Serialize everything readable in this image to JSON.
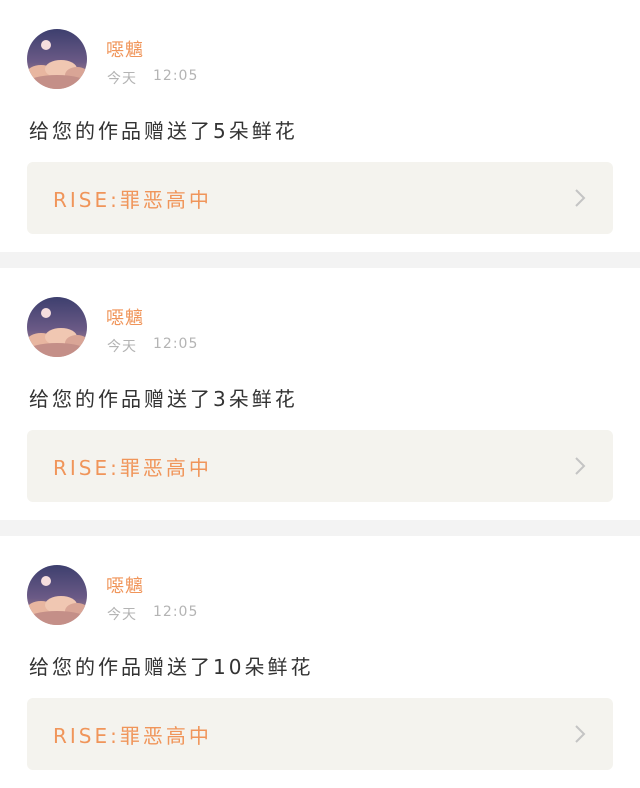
{
  "colors": {
    "accent": "#f0955a",
    "meta": "#b4b4b4",
    "text": "#333333",
    "link_bg": "#f4f3ee",
    "separator": "#f3f3f3"
  },
  "notifications": [
    {
      "user": "噁魑",
      "day": "今天",
      "time": "12:05",
      "message": "给您的作品赠送了5朵鲜花",
      "work_title": "RISE:罪恶高中",
      "avatar_icon": "avatar-moon-clouds",
      "chevron_icon": "chevron-right-icon"
    },
    {
      "user": "噁魑",
      "day": "今天",
      "time": "12:05",
      "message": "给您的作品赠送了3朵鲜花",
      "work_title": "RISE:罪恶高中",
      "avatar_icon": "avatar-moon-clouds",
      "chevron_icon": "chevron-right-icon"
    },
    {
      "user": "噁魑",
      "day": "今天",
      "time": "12:05",
      "message": "给您的作品赠送了10朵鲜花",
      "work_title": "RISE:罪恶高中",
      "avatar_icon": "avatar-moon-clouds",
      "chevron_icon": "chevron-right-icon"
    }
  ]
}
